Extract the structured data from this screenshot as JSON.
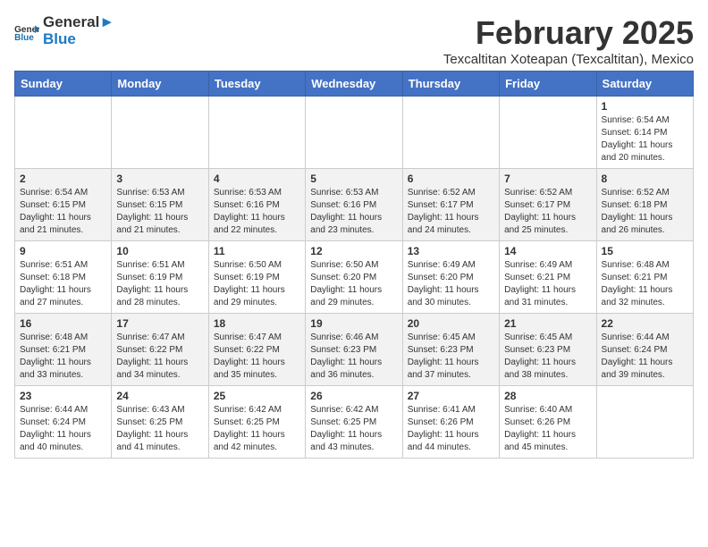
{
  "logo": {
    "general": "General",
    "blue": "Blue"
  },
  "title": "February 2025",
  "location": "Texcaltitan Xoteapan (Texcaltitan), Mexico",
  "weekdays": [
    "Sunday",
    "Monday",
    "Tuesday",
    "Wednesday",
    "Thursday",
    "Friday",
    "Saturday"
  ],
  "weeks": [
    [
      {
        "day": "",
        "info": ""
      },
      {
        "day": "",
        "info": ""
      },
      {
        "day": "",
        "info": ""
      },
      {
        "day": "",
        "info": ""
      },
      {
        "day": "",
        "info": ""
      },
      {
        "day": "",
        "info": ""
      },
      {
        "day": "1",
        "info": "Sunrise: 6:54 AM\nSunset: 6:14 PM\nDaylight: 11 hours and 20 minutes."
      }
    ],
    [
      {
        "day": "2",
        "info": "Sunrise: 6:54 AM\nSunset: 6:15 PM\nDaylight: 11 hours and 21 minutes."
      },
      {
        "day": "3",
        "info": "Sunrise: 6:53 AM\nSunset: 6:15 PM\nDaylight: 11 hours and 21 minutes."
      },
      {
        "day": "4",
        "info": "Sunrise: 6:53 AM\nSunset: 6:16 PM\nDaylight: 11 hours and 22 minutes."
      },
      {
        "day": "5",
        "info": "Sunrise: 6:53 AM\nSunset: 6:16 PM\nDaylight: 11 hours and 23 minutes."
      },
      {
        "day": "6",
        "info": "Sunrise: 6:52 AM\nSunset: 6:17 PM\nDaylight: 11 hours and 24 minutes."
      },
      {
        "day": "7",
        "info": "Sunrise: 6:52 AM\nSunset: 6:17 PM\nDaylight: 11 hours and 25 minutes."
      },
      {
        "day": "8",
        "info": "Sunrise: 6:52 AM\nSunset: 6:18 PM\nDaylight: 11 hours and 26 minutes."
      }
    ],
    [
      {
        "day": "9",
        "info": "Sunrise: 6:51 AM\nSunset: 6:18 PM\nDaylight: 11 hours and 27 minutes."
      },
      {
        "day": "10",
        "info": "Sunrise: 6:51 AM\nSunset: 6:19 PM\nDaylight: 11 hours and 28 minutes."
      },
      {
        "day": "11",
        "info": "Sunrise: 6:50 AM\nSunset: 6:19 PM\nDaylight: 11 hours and 29 minutes."
      },
      {
        "day": "12",
        "info": "Sunrise: 6:50 AM\nSunset: 6:20 PM\nDaylight: 11 hours and 29 minutes."
      },
      {
        "day": "13",
        "info": "Sunrise: 6:49 AM\nSunset: 6:20 PM\nDaylight: 11 hours and 30 minutes."
      },
      {
        "day": "14",
        "info": "Sunrise: 6:49 AM\nSunset: 6:21 PM\nDaylight: 11 hours and 31 minutes."
      },
      {
        "day": "15",
        "info": "Sunrise: 6:48 AM\nSunset: 6:21 PM\nDaylight: 11 hours and 32 minutes."
      }
    ],
    [
      {
        "day": "16",
        "info": "Sunrise: 6:48 AM\nSunset: 6:21 PM\nDaylight: 11 hours and 33 minutes."
      },
      {
        "day": "17",
        "info": "Sunrise: 6:47 AM\nSunset: 6:22 PM\nDaylight: 11 hours and 34 minutes."
      },
      {
        "day": "18",
        "info": "Sunrise: 6:47 AM\nSunset: 6:22 PM\nDaylight: 11 hours and 35 minutes."
      },
      {
        "day": "19",
        "info": "Sunrise: 6:46 AM\nSunset: 6:23 PM\nDaylight: 11 hours and 36 minutes."
      },
      {
        "day": "20",
        "info": "Sunrise: 6:45 AM\nSunset: 6:23 PM\nDaylight: 11 hours and 37 minutes."
      },
      {
        "day": "21",
        "info": "Sunrise: 6:45 AM\nSunset: 6:23 PM\nDaylight: 11 hours and 38 minutes."
      },
      {
        "day": "22",
        "info": "Sunrise: 6:44 AM\nSunset: 6:24 PM\nDaylight: 11 hours and 39 minutes."
      }
    ],
    [
      {
        "day": "23",
        "info": "Sunrise: 6:44 AM\nSunset: 6:24 PM\nDaylight: 11 hours and 40 minutes."
      },
      {
        "day": "24",
        "info": "Sunrise: 6:43 AM\nSunset: 6:25 PM\nDaylight: 11 hours and 41 minutes."
      },
      {
        "day": "25",
        "info": "Sunrise: 6:42 AM\nSunset: 6:25 PM\nDaylight: 11 hours and 42 minutes."
      },
      {
        "day": "26",
        "info": "Sunrise: 6:42 AM\nSunset: 6:25 PM\nDaylight: 11 hours and 43 minutes."
      },
      {
        "day": "27",
        "info": "Sunrise: 6:41 AM\nSunset: 6:26 PM\nDaylight: 11 hours and 44 minutes."
      },
      {
        "day": "28",
        "info": "Sunrise: 6:40 AM\nSunset: 6:26 PM\nDaylight: 11 hours and 45 minutes."
      },
      {
        "day": "",
        "info": ""
      }
    ]
  ]
}
